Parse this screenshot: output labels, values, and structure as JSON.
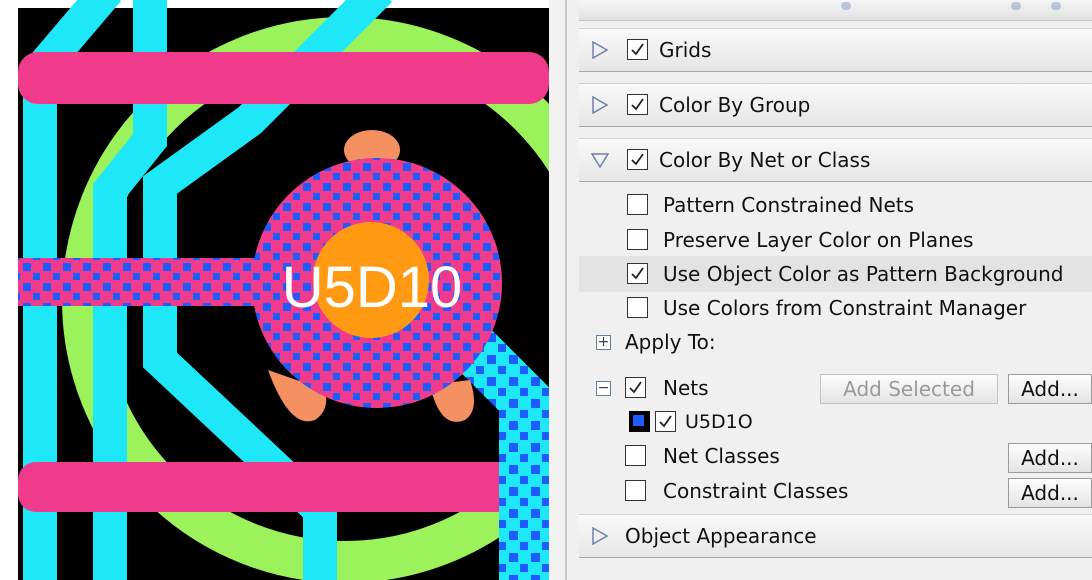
{
  "canvas": {
    "component_label": "U5D10",
    "colors": {
      "background": "#000000",
      "cyan_trace": "#1ee8f8",
      "green_ring": "#9cf25a",
      "magenta_trace": "#f03a8c",
      "orange_pad": "#ff9a12",
      "salmon_pad": "#f59060",
      "pattern_blue": "#1d5cff"
    }
  },
  "panel": {
    "sections": {
      "grids": {
        "label": "Grids",
        "expanded": false,
        "checked": true
      },
      "color_by_group": {
        "label": "Color By Group",
        "expanded": false,
        "checked": true
      },
      "color_by_net": {
        "label": "Color By Net or Class",
        "expanded": true,
        "checked": true
      },
      "object_appearance": {
        "label": "Object Appearance",
        "expanded": false
      }
    },
    "options": [
      {
        "label": "Pattern Constrained Nets",
        "checked": false
      },
      {
        "label": "Preserve Layer Color on Planes",
        "checked": false
      },
      {
        "label": "Use Object Color as Pattern Background",
        "checked": true
      },
      {
        "label": "Use Colors from Constraint Manager",
        "checked": false
      }
    ],
    "apply_to": {
      "label": "Apply To:",
      "toggle": "+"
    },
    "nets": {
      "toggle": "−",
      "label": "Nets",
      "checked": true,
      "add_selected_label": "Add Selected",
      "add_label": "Add...",
      "items": [
        {
          "label": "U5D1O",
          "checked": true
        }
      ]
    },
    "net_classes": {
      "label": "Net Classes",
      "checked": false,
      "add_label": "Add..."
    },
    "constraint_classes": {
      "label": "Constraint Classes",
      "checked": false,
      "add_label": "Add..."
    }
  }
}
